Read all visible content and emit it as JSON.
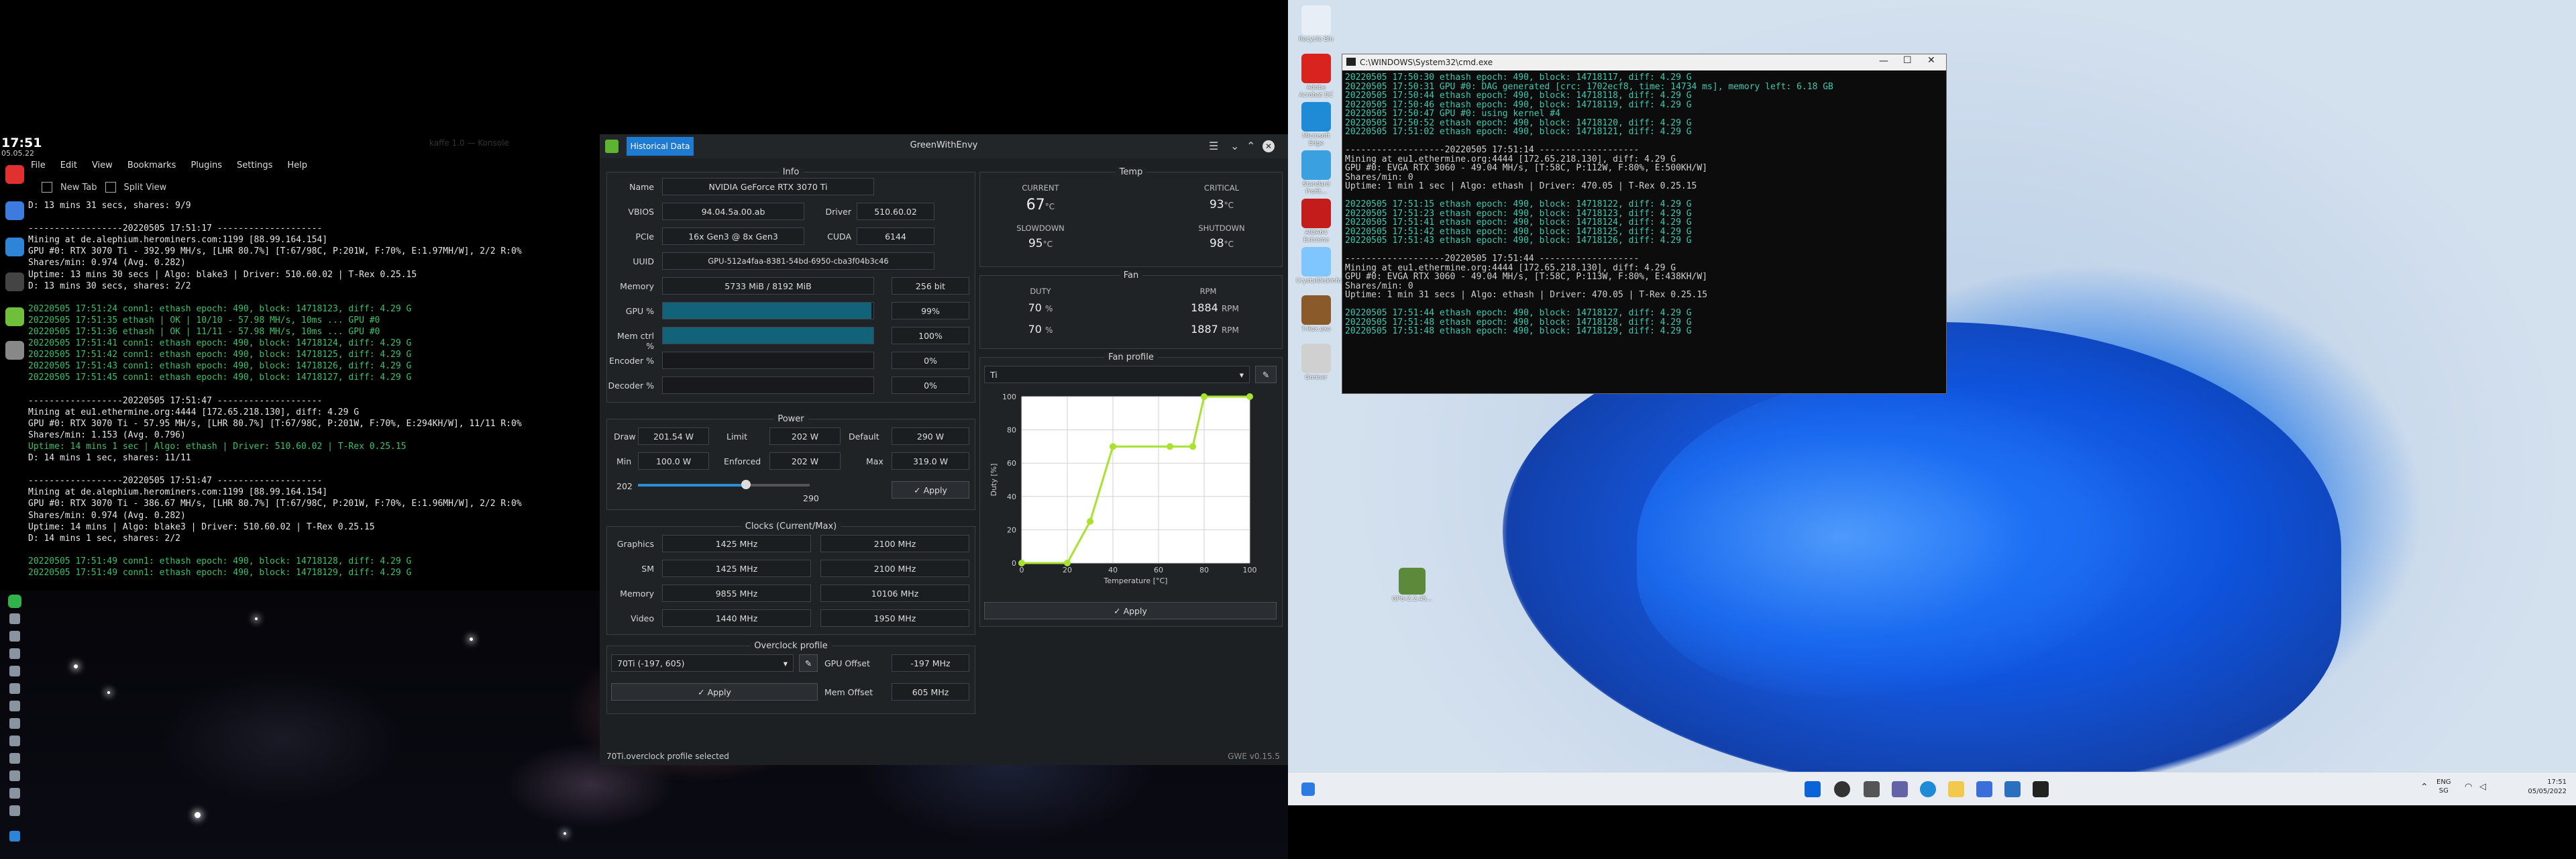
{
  "linux": {
    "clock": "17:51",
    "date": "05.05.22",
    "window_title": "kaffe 1.0 — Konsole",
    "menu": [
      "File",
      "Edit",
      "View",
      "Bookmarks",
      "Plugins",
      "Settings",
      "Help"
    ],
    "toolbar": {
      "new_tab": "New Tab",
      "split_view": "Split View"
    },
    "terminal_lines": [
      "D: 13 mins 31 secs, shares: 9/9",
      "",
      "------------------20220505 17:51:17 --------------------",
      "Mining at de.alephium.herominers.com:1199 [88.99.164.154]",
      "GPU #0: RTX 3070 Ti - 392.99 MH/s, [LHR 80.7%] [T:67/98C, P:201W, F:70%, E:1.97MH/W], 2/2 R:0%",
      "Shares/min: 0.974 (Avg. 0.282)",
      "Uptime: 13 mins 30 secs | Algo: blake3 | Driver: 510.60.02 | T-Rex 0.25.15",
      "D: 13 mins 30 secs, shares: 2/2",
      "",
      "20220505 17:51:24 conn1: ethash epoch: 490, block: 14718123, diff: 4.29 G",
      "20220505 17:51:35 ethash | OK | 10/10 - 57.98 MH/s, 10ms ... GPU #0",
      "20220505 17:51:36 ethash | OK | 11/11 - 57.98 MH/s, 10ms ... GPU #0",
      "20220505 17:51:41 conn1: ethash epoch: 490, block: 14718124, diff: 4.29 G",
      "20220505 17:51:42 conn1: ethash epoch: 490, block: 14718125, diff: 4.29 G",
      "20220505 17:51:43 conn1: ethash epoch: 490, block: 14718126, diff: 4.29 G",
      "20220505 17:51:45 conn1: ethash epoch: 490, block: 14718127, diff: 4.29 G",
      "",
      "------------------20220505 17:51:47 --------------------",
      "Mining at eu1.ethermine.org:4444 [172.65.218.130], diff: 4.29 G",
      "GPU #0: RTX 3070 Ti - 57.95 MH/s, [LHR 80.7%] [T:67/98C, P:201W, F:70%, E:294KH/W], 11/11 R:0%",
      "Shares/min: 1.153 (Avg. 0.796)",
      "Uptime: 14 mins 1 sec | Algo: ethash | Driver: 510.60.02 | T-Rex 0.25.15",
      "D: 14 mins 1 sec, shares: 11/11",
      "",
      "------------------20220505 17:51:47 --------------------",
      "Mining at de.alephium.herominers.com:1199 [88.99.164.154]",
      "GPU #0: RTX 3070 Ti - 386.67 MH/s, [LHR 80.7%] [T:67/98C, P:201W, F:70%, E:1.96MH/W], 2/2 R:0%",
      "Shares/min: 0.974 (Avg. 0.282)",
      "Uptime: 14 mins | Algo: blake3 | Driver: 510.60.02 | T-Rex 0.25.15",
      "D: 14 mins 1 sec, shares: 2/2",
      "",
      "20220505 17:51:49 conn1: ethash epoch: 490, block: 14718128, diff: 4.29 G",
      "20220505 17:51:49 conn1: ethash epoch: 490, block: 14718129, diff: 4.29 G"
    ]
  },
  "gwe": {
    "title": "GreenWithEnvy",
    "tab": "Historical Data",
    "status": "70Ti.overclock profile selected",
    "version": "GWE v0.15.5",
    "info": {
      "title": "Info",
      "rows": [
        {
          "label": "Name",
          "value": "NVIDIA GeForce RTX 3070 Ti"
        },
        {
          "label": "VBIOS",
          "value": "94.04.5a.00.ab",
          "label2": "Driver",
          "value2": "510.60.02"
        },
        {
          "label": "PCIe",
          "value": "16x Gen3 @ 8x Gen3",
          "label2": "CUDA",
          "value2": "6144"
        },
        {
          "label": "UUID",
          "value": "GPU-512a4faa-8381-54bd-6950-cba3f04b3c46"
        },
        {
          "label": "Memory",
          "value": "5733 MiB / 8192 MiB",
          "value2": "256 bit"
        }
      ],
      "bars": [
        {
          "label": "GPU %",
          "value": "99%",
          "fill": 0.99
        },
        {
          "label": "Mem ctrl %",
          "value": "100%",
          "fill": 1.0
        },
        {
          "label": "Encoder %",
          "value": "0%",
          "fill": 0
        },
        {
          "label": "Decoder %",
          "value": "0%",
          "fill": 0
        }
      ]
    },
    "power": {
      "title": "Power",
      "draw_label": "Draw",
      "draw": "201.54 W",
      "limit_label": "Limit",
      "limit": "202 W",
      "default_label": "Default",
      "default": "290 W",
      "min_label": "Min",
      "min": "100.0 W",
      "enforced_label": "Enforced",
      "enforced": "202 W",
      "max_label": "Max",
      "max": "319.0 W",
      "slider_value": "202",
      "slider_max": "290",
      "slider_fraction": 0.63,
      "apply": "✓ Apply"
    },
    "clocks": {
      "title": "Clocks (Current/Max)",
      "rows": [
        {
          "label": "Graphics",
          "cur": "1425 MHz",
          "max": "2100 MHz"
        },
        {
          "label": "SM",
          "cur": "1425 MHz",
          "max": "2100 MHz"
        },
        {
          "label": "Memory",
          "cur": "9855 MHz",
          "max": "10106 MHz"
        },
        {
          "label": "Video",
          "cur": "1440 MHz",
          "max": "1950 MHz"
        }
      ]
    },
    "overclock": {
      "title": "Overclock profile",
      "profile": "70Ti (-197, 605)",
      "gpu_offset_label": "GPU Offset",
      "gpu_offset": "-197 MHz",
      "mem_offset_label": "Mem Offset",
      "mem_offset": "605 MHz",
      "apply": "✓ Apply"
    },
    "temp": {
      "title": "Temp",
      "current_label": "CURRENT",
      "current": "67",
      "current_unit": "°C",
      "critical_label": "CRITICAL",
      "critical": "93",
      "critical_unit": "°C",
      "slowdown_label": "SLOWDOWN",
      "slowdown": "95",
      "slowdown_unit": "°C",
      "shutdown_label": "SHUTDOWN",
      "shutdown": "98",
      "shutdown_unit": "°C"
    },
    "fan": {
      "title": "Fan",
      "duty_label": "DUTY",
      "rpm_label": "RPM",
      "rows": [
        {
          "duty": "70",
          "duty_unit": "%",
          "rpm": "1884",
          "rpm_unit": "RPM"
        },
        {
          "duty": "70",
          "duty_unit": "%",
          "rpm": "1887",
          "rpm_unit": "RPM"
        }
      ]
    },
    "fan_profile": {
      "title": "Fan profile",
      "profile": "Ti",
      "apply": "✓ Apply",
      "xlabel": "Temperature [°C]",
      "ylabel": "Duty [%]",
      "xticks": [
        "0",
        "20",
        "40",
        "60",
        "80",
        "100"
      ],
      "yticks": [
        "0",
        "20",
        "40",
        "60",
        "80",
        "100"
      ],
      "colors": {
        "line": "#a6e22e",
        "grid": "#d0d0d0",
        "bg": "#ffffff"
      }
    }
  },
  "chart_data": {
    "type": "line",
    "x": [
      0,
      20,
      30,
      40,
      65,
      75,
      80,
      100
    ],
    "values": [
      0,
      0,
      25,
      70,
      70,
      70,
      100,
      100
    ],
    "xlabel": "Temperature [°C]",
    "ylabel": "Duty [%]",
    "xlim": [
      0,
      100
    ],
    "ylim": [
      0,
      100
    ],
    "grid": true
  },
  "windows": {
    "term_title": "C:\\WINDOWS\\System32\\cmd.exe",
    "term_lines": [
      "20220505 17:50:30 ethash epoch: 490, block: 14718117, diff: 4.29 G",
      "20220505 17:50:31 GPU #0: DAG generated [crc: 1702ecf8, time: 14734 ms], memory left: 6.18 GB",
      "20220505 17:50:44 ethash epoch: 490, block: 14718118, diff: 4.29 G",
      "20220505 17:50:46 ethash epoch: 490, block: 14718119, diff: 4.29 G",
      "20220505 17:50:47 GPU #0: using kernel #4",
      "20220505 17:50:52 ethash epoch: 490, block: 14718120, diff: 4.29 G",
      "20220505 17:51:02 ethash epoch: 490, block: 14718121, diff: 4.29 G",
      "",
      "-------------------20220505 17:51:14 -------------------",
      "Mining at eu1.ethermine.org:4444 [172.65.218.130], diff: 4.29 G",
      "GPU #0: EVGA RTX 3060 - 49.04 MH/s, [T:58C, P:112W, F:80%, E:500KH/W]",
      "Shares/min: 0",
      "Uptime: 1 min 1 sec | Algo: ethash | Driver: 470.05 | T-Rex 0.25.15",
      "",
      "20220505 17:51:15 ethash epoch: 490, block: 14718122, diff: 4.29 G",
      "20220505 17:51:23 ethash epoch: 490, block: 14718123, diff: 4.29 G",
      "20220505 17:51:41 ethash epoch: 490, block: 14718124, diff: 4.29 G",
      "20220505 17:51:42 ethash epoch: 490, block: 14718125, diff: 4.29 G",
      "20220505 17:51:43 ethash epoch: 490, block: 14718126, diff: 4.29 G",
      "",
      "-------------------20220505 17:51:44 -------------------",
      "Mining at eu1.ethermine.org:4444 [172.65.218.130], diff: 4.29 G",
      "GPU #0: EVGA RTX 3060 - 49.04 MH/s, [T:58C, P:113W, F:80%, E:438KH/W]",
      "Shares/min: 0",
      "Uptime: 1 min 31 secs | Algo: ethash | Driver: 470.05 | T-Rex 0.25.15",
      "",
      "20220505 17:51:44 ethash epoch: 490, block: 14718127, diff: 4.29 G",
      "20220505 17:51:48 ethash epoch: 490, block: 14718128, diff: 4.29 G",
      "20220505 17:51:48 ethash epoch: 490, block: 14718129, diff: 4.29 G"
    ],
    "desktop_icons": [
      {
        "label": "Recycle Bin",
        "color": "#e8eef6"
      },
      {
        "label": "Adobe Acrobat DC",
        "color": "#d9231f"
      },
      {
        "label": "Microsoft Edge",
        "color": "#1f8ad6"
      },
      {
        "label": "Standard Profit...",
        "color": "#3aa0e0"
      },
      {
        "label": "AIDA64 Extreme",
        "color": "#c41b1b"
      },
      {
        "label": "CrystalDiskInfo",
        "color": "#7fc6ff"
      },
      {
        "label": "T-Rex.exe",
        "color": "#8a5a2b"
      },
      {
        "label": "Gminer",
        "color": "#d0d0d0"
      }
    ],
    "extra_icon": "GPU-Z.2.45...",
    "tray": {
      "lang": "ENG",
      "region": "SG",
      "time": "17:51",
      "date": "05/05/2022"
    }
  }
}
